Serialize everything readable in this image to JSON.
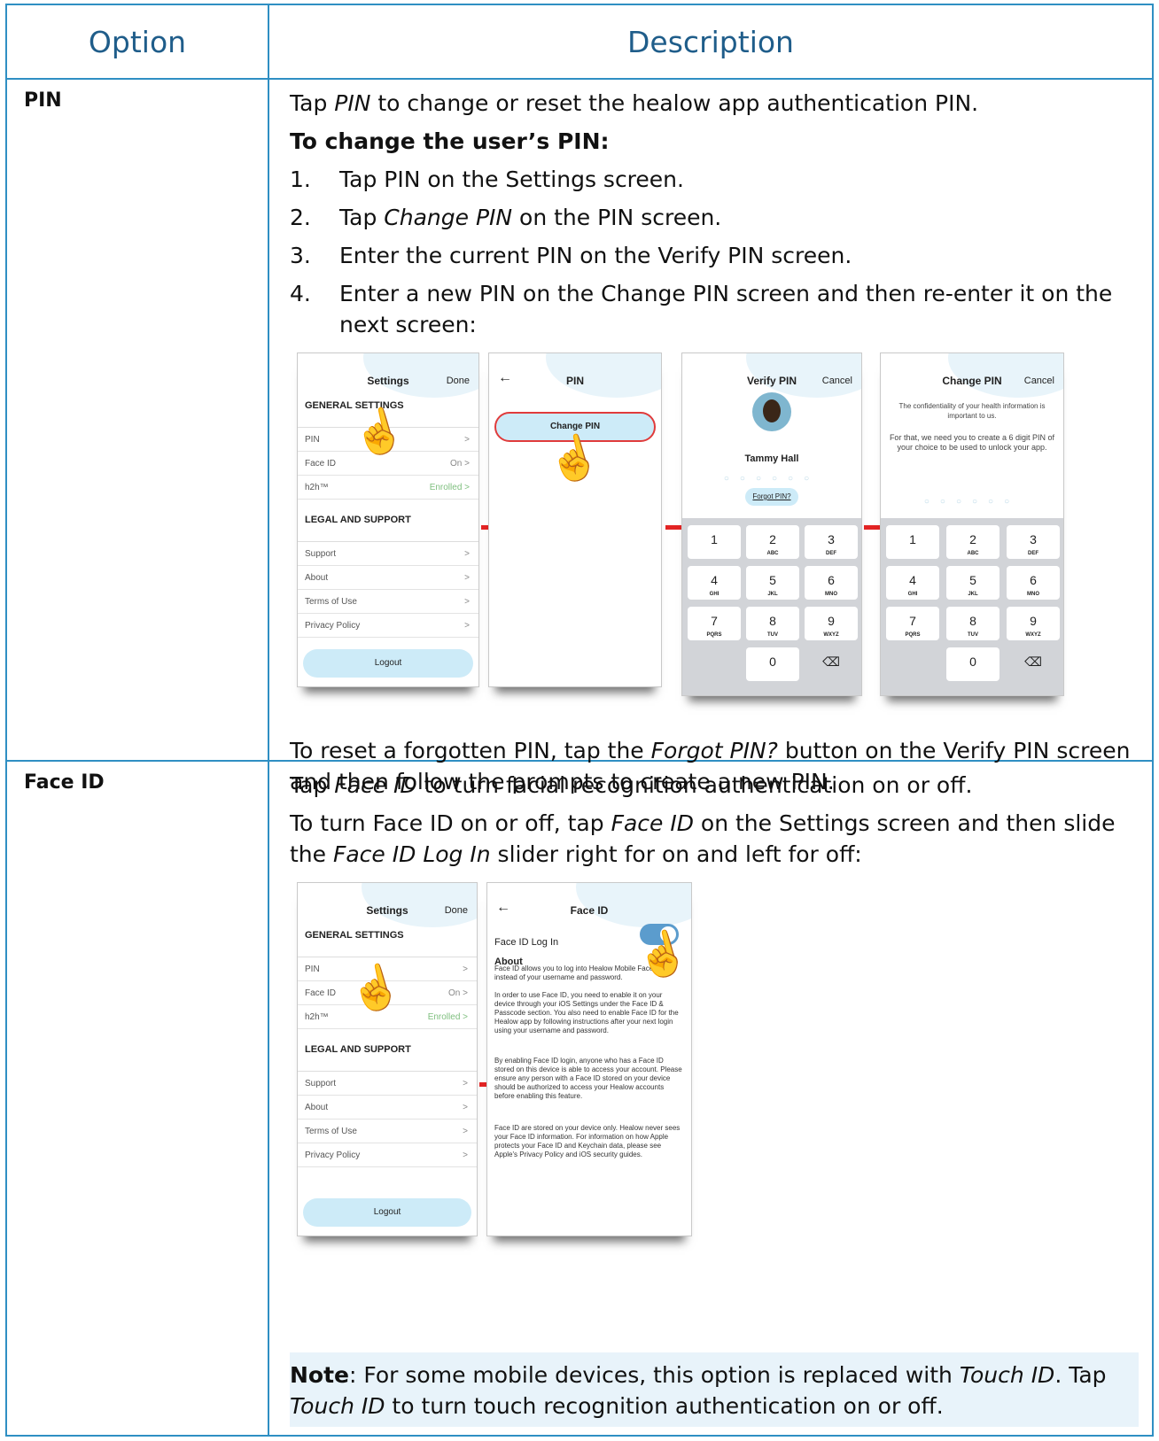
{
  "table": {
    "header_option": "Option",
    "header_description": "Description"
  },
  "pin": {
    "name": "PIN",
    "intro_pre": "Tap ",
    "intro_em": "PIN",
    "intro_post": " to change or reset the healow app authentication PIN.",
    "change_heading": "To change the user’s PIN:",
    "steps": [
      {
        "num": "1.",
        "pre": "Tap PIN on the Settings screen.",
        "em": "",
        "post": ""
      },
      {
        "num": "2.",
        "pre": "Tap ",
        "em": "Change PIN",
        "post": " on the PIN screen."
      },
      {
        "num": "3.",
        "pre": "Enter the current PIN on the Verify PIN screen.",
        "em": "",
        "post": ""
      },
      {
        "num": "4.",
        "pre": "Enter a new PIN on the Change PIN screen and then re-enter it on the next screen:",
        "em": "",
        "post": ""
      }
    ],
    "reset_pre": "To reset a forgotten PIN, tap the ",
    "reset_em": "Forgot PIN?",
    "reset_post": " button on the Verify PIN screen and then follow the prompts to create a new PIN."
  },
  "faceid": {
    "name": "Face ID",
    "intro_pre": "Tap ",
    "intro_em": "Face ID",
    "intro_post": " to turn facial recognition authentication on or off.",
    "turn_pre": "To turn Face ID on or off, tap ",
    "turn_em1": "Face ID",
    "turn_mid": " on the Settings screen and then slide the ",
    "turn_em2": "Face ID Log In",
    "turn_post": " slider right for on and left for off:",
    "note_label": "Note",
    "note_pre": ": For some mobile devices, this option is replaced with ",
    "note_em1": "Touch ID",
    "note_mid": ". Tap ",
    "note_em2": "Touch ID",
    "note_post": " to turn touch recognition authentication on or off."
  },
  "mock": {
    "settings_title": "Settings",
    "done": "Done",
    "general_settings": "GENERAL SETTINGS",
    "row_pin": "PIN",
    "row_faceid": "Face ID",
    "row_faceid_val": "On >",
    "row_h2h": "h2h™",
    "row_h2h_val": "Enrolled >",
    "legal_support": "LEGAL AND SUPPORT",
    "row_support": "Support",
    "row_about": "About",
    "row_terms": "Terms of Use",
    "row_privacy": "Privacy Policy",
    "chev": ">",
    "logout": "Logout",
    "back": "←",
    "pin_title": "PIN",
    "change_pin": "Change PIN",
    "verify_title": "Verify PIN",
    "cancel": "Cancel",
    "user_name": "Tammy Hall",
    "pin_dots": "○○○○○○",
    "forgot": "Forgot PIN?",
    "change_title": "Change PIN",
    "conf1": "The confidentiality of your health information is important to us.",
    "conf2": "For that, we need you to create a 6 digit PIN of your choice to be used to unlock your app.",
    "keys": [
      {
        "d": "1",
        "s": ""
      },
      {
        "d": "2",
        "s": "ABC"
      },
      {
        "d": "3",
        "s": "DEF"
      },
      {
        "d": "4",
        "s": "GHI"
      },
      {
        "d": "5",
        "s": "JKL"
      },
      {
        "d": "6",
        "s": "MNO"
      },
      {
        "d": "7",
        "s": "PQRS"
      },
      {
        "d": "8",
        "s": "TUV"
      },
      {
        "d": "9",
        "s": "WXYZ"
      },
      {
        "d": "",
        "s": ""
      },
      {
        "d": "0",
        "s": ""
      },
      {
        "d": "⌫",
        "s": ""
      }
    ],
    "face_title": "Face ID",
    "face_login": "Face ID Log In",
    "about": "About",
    "face_p1": "Face ID allows you to log into Healow Mobile Face ID instead of your username and password.",
    "face_p2": "In order to use Face ID, you need to enable it on your device through your iOS Settings under the Face ID & Passcode section. You also need to enable Face ID for the Healow app by following instructions after your next login using your username and password.",
    "face_p3": "By enabling Face ID login, anyone who has a Face ID stored on this device is able to access your account. Please ensure any person with a Face ID stored on your device should be authorized to access your Healow accounts before enabling this feature.",
    "face_p4": "Face ID are stored on your device only. Healow never sees your Face ID information. For information on how Apple protects your Face ID and Keychain data, please see Apple's Privacy Policy and iOS security guides.",
    "hand_icon": "☝"
  }
}
